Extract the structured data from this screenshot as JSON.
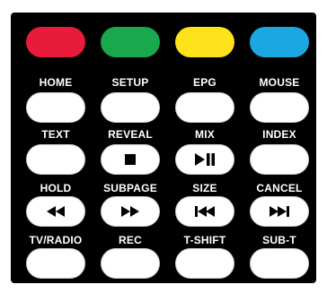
{
  "color_buttons": [
    {
      "name": "red",
      "color": "#e81b3a"
    },
    {
      "name": "green",
      "color": "#1aa84f"
    },
    {
      "name": "yellow",
      "color": "#fde21c"
    },
    {
      "name": "blue",
      "color": "#1ba8e0"
    }
  ],
  "rows": [
    {
      "labels": [
        "HOME",
        "SETUP",
        "EPG",
        "MOUSE"
      ],
      "icons": [
        "",
        "",
        "",
        ""
      ]
    },
    {
      "labels": [
        "TEXT",
        "REVEAL",
        "MIX",
        "INDEX"
      ],
      "icons": [
        "",
        "stop-icon",
        "play-pause-icon",
        ""
      ]
    },
    {
      "labels": [
        "HOLD",
        "SUBPAGE",
        "SIZE",
        "CANCEL"
      ],
      "icons": [
        "rewind-icon",
        "fast-forward-icon",
        "skip-back-icon",
        "skip-forward-icon"
      ]
    },
    {
      "labels": [
        "TV/RADIO",
        "REC",
        "T-SHIFT",
        "SUB-T"
      ],
      "icons": [
        "",
        "",
        "",
        ""
      ]
    }
  ]
}
